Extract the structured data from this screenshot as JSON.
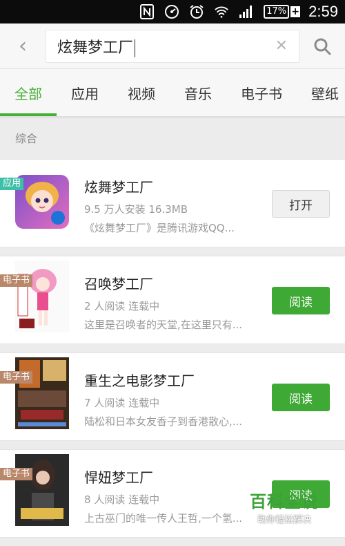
{
  "status_bar": {
    "battery": "17%",
    "battery_charging_symbol": "+",
    "time": "2:59",
    "icons": [
      "nfc-icon",
      "gauge-icon",
      "alarm-icon",
      "wifi-icon",
      "signal-icon",
      "battery-icon"
    ]
  },
  "search": {
    "back_symbol": "‹",
    "query": "炫舞梦工厂",
    "clear_symbol": "✕"
  },
  "tabs": [
    {
      "label": "全部",
      "active": true
    },
    {
      "label": "应用",
      "active": false
    },
    {
      "label": "视频",
      "active": false
    },
    {
      "label": "音乐",
      "active": false
    },
    {
      "label": "电子书",
      "active": false
    },
    {
      "label": "壁纸",
      "active": false
    }
  ],
  "section_label": "综合",
  "results": [
    {
      "badge": "应用",
      "title": "炫舞梦工厂",
      "meta": "9.5 万人安装  16.3MB",
      "desc": "《炫舞梦工厂》是腾讯游戏QQ...",
      "button": "打开"
    },
    {
      "badge": "电子书",
      "title": "召唤梦工厂",
      "meta": "2 人阅读  连载中",
      "desc": "这里是召唤者的天堂,在这里只有...",
      "button": "阅读"
    },
    {
      "badge": "电子书",
      "title": "重生之电影梦工厂",
      "meta": "7 人阅读  连载中",
      "desc": "陆松和日本女友香子到香港散心,...",
      "button": "阅读"
    },
    {
      "badge": "电子书",
      "title": "悍妞梦工厂",
      "meta": "8 人阅读  连载中",
      "desc": "上古巫门的唯一传人王哲,一个氢...",
      "button": "阅读"
    }
  ],
  "watermark": {
    "title": "百科全说",
    "subtitle": "助你轻松解决"
  },
  "colors": {
    "accent": "#45b035",
    "read_button": "#3fa936",
    "app_badge": "#3dbfa8",
    "book_badge": "#b9876a"
  }
}
